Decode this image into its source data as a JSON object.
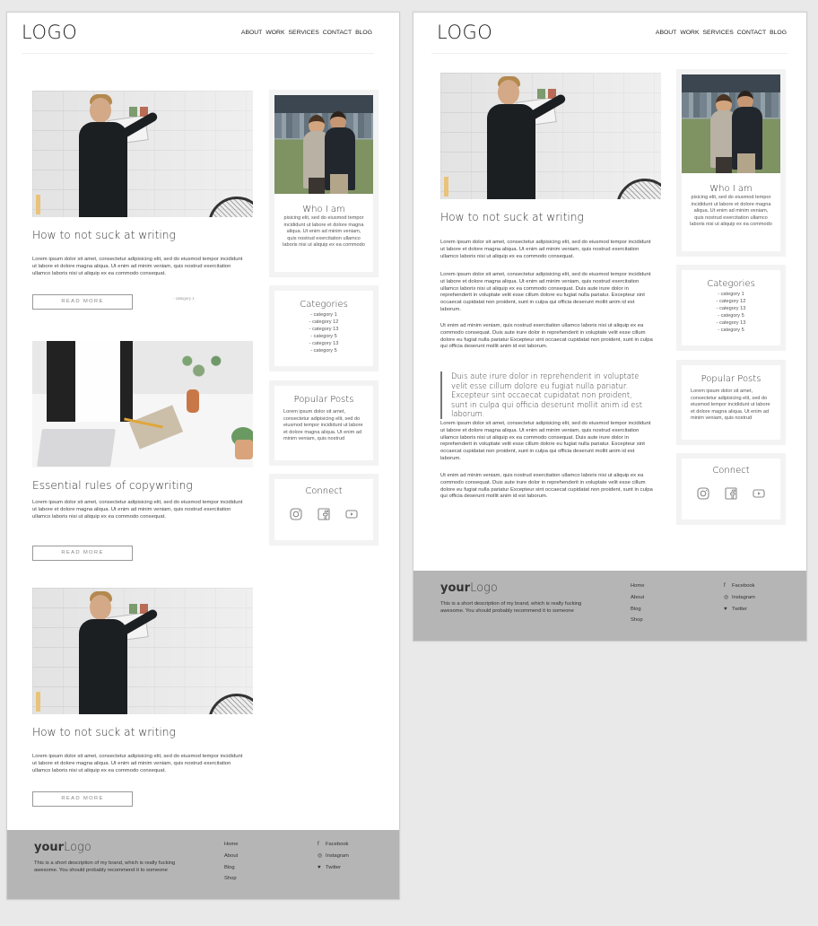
{
  "logo": "LOGO",
  "nav": [
    "ABOUT",
    "WORK",
    "SERVICES",
    "CONTACT",
    "BLOG"
  ],
  "posts": [
    {
      "title": "How to not suck at writing",
      "excerpt": "Lorem ipsum dolor sit amet, consectetur adipisicing elit, sed do eiusmod tempor incididunt ut labore et dolore magna aliqua. Ut enim ad minim veniam, quis nostrud exercitation ullamco laboris nisi ut aliquip ex ea commodo consequat.",
      "read_more": "READ MORE",
      "category_tag": "- category 1"
    },
    {
      "title": "Essential rules of copywriting",
      "excerpt": "Lorem ipsum dolor sit amet, consectetur adipisicing elit, sed do eiusmod tempor incididunt ut labore et dolore magna aliqua. Ut enim ad minim veniam, quis nostrud exercitation ullamco laboris nisi ut aliquip ex ea commodo consequat.",
      "read_more": "READ MORE"
    },
    {
      "title": "How to not suck at writing",
      "excerpt": "Lorem ipsum dolor sit amet, consectetur adipisicing elit, sed do eiusmod tempor incididunt ut labore et dolore magna aliqua. Ut enim ad minim veniam, quis nostrud exercitation ullamco laboris nisi ut aliquip ex ea commodo consequat.",
      "read_more": "READ MORE"
    }
  ],
  "sidebar": {
    "who": {
      "title": "Who I am",
      "text": "pisicing elit, sed do eiusmod tempor incididunt ut labore et dolore magna aliqua. Ut enim ad minim veniam, quis nostrud exercitation ullamco laboris nisi ut aliquip ex ea commodo"
    },
    "categories": {
      "title": "Categories",
      "items": [
        "- category 1",
        "- category 12",
        "- category 13",
        "- category 5",
        "- category 13",
        "- category 5"
      ]
    },
    "popular": {
      "title": "Popular Posts",
      "text": "Lorem ipsum dolor sit amet, consectetur adipisicing elit, sed do eiusmod tempor incididunt ut labore et dolore magna aliqua. Ut enim ad minim veniam, quis nostrud"
    },
    "connect": {
      "title": "Connect",
      "icons": [
        "instagram-icon",
        "facebook-icon",
        "youtube-icon"
      ]
    }
  },
  "article": {
    "title": "How to not suck at writing",
    "p1": "Lorem ipsum dolor sit amet, consectetur adipisicing elit, sed do eiusmod tempor incididunt ut labore et dolore magna aliqua. Ut enim ad minim veniam, quis nostrud exercitation ullamco laboris nisi ut aliquip ex ea commodo consequat.",
    "p2": "Lorem ipsum dolor sit amet, consectetur adipisicing elit, sed do eiusmod tempor incididunt ut labore et dolore magna aliqua. Ut enim ad minim veniam, quis nostrud exercitation ullamco laboris nisi ut aliquip ex ea commodo consequat. Duis aute irure dolor in reprehenderit in voluptate velit esse cillum dolore eu fugiat nulla pariatur. Excepteur sint occaecat cupidatat non proident, sunt in culpa qui officia deserunt mollit anim id est laborum.",
    "p3": "Ut enim ad minim veniam, quis nostrud exercitation ullamco laboris nisi ut aliquip ex ea commodo consequat. Duis aute irure dolor in reprehenderit in voluptate velit esse cillum dolore eu fugiat nulla pariatur Excepteur sint occaecat cupidatat non proident, sunt in culpa qui officia deserunt mollit anim id est laborum.",
    "quote": "Duis aute irure dolor in reprehenderit in voluptate velit esse cillum dolore eu fugiat nulla pariatur. Excepteur sint occaecat cupidatat non proident, sunt in culpa qui officia deserunt mollit anim id est laborum.",
    "p4": "Lorem ipsum dolor sit amet, consectetur adipisicing elit, sed do eiusmod tempor incididunt ut labore et dolore magna aliqua. Ut enim ad minim veniam, quis nostrud exercitation ullamco laboris nisi ut aliquip ex ea commodo consequat. Duis aute irure dolor in reprehenderit in voluptate velit esse cillum dolore eu fugiat nulla pariatur. Excepteur sint occaecat cupidatat non proident, sunt in culpa qui officia deserunt mollit anim id est laborum.",
    "p5": "Ut enim ad minim veniam, quis nostrud exercitation ullamco laboris nisi ut aliquip ex ea commodo consequat. Duis aute irure dolor in reprehenderit in voluptate velit esse cillum dolore eu fugiat nulla pariatur Excepteur sint occaecat cupidatat non proident, sunt in culpa qui officia deserunt mollit anim id est laborum."
  },
  "footer": {
    "logo_bold": "your",
    "logo_light": "Logo",
    "description": "This is a short description of my brand, which is really fucking awesome. You should probably recommend it to someone",
    "links": [
      "Home",
      "About",
      "Blog",
      "Shop"
    ],
    "social": [
      {
        "icon": "facebook-icon",
        "glyph": "f",
        "label": "Facebook"
      },
      {
        "icon": "instagram-icon",
        "glyph": "◎",
        "label": "Instagram"
      },
      {
        "icon": "twitter-icon",
        "glyph": "♥",
        "label": "Twitter"
      }
    ]
  },
  "colors": {
    "background": "#e9e9ea",
    "footer": "#b5b5b5",
    "sidebar_box": "#f3f3f3",
    "text": "#333333"
  }
}
